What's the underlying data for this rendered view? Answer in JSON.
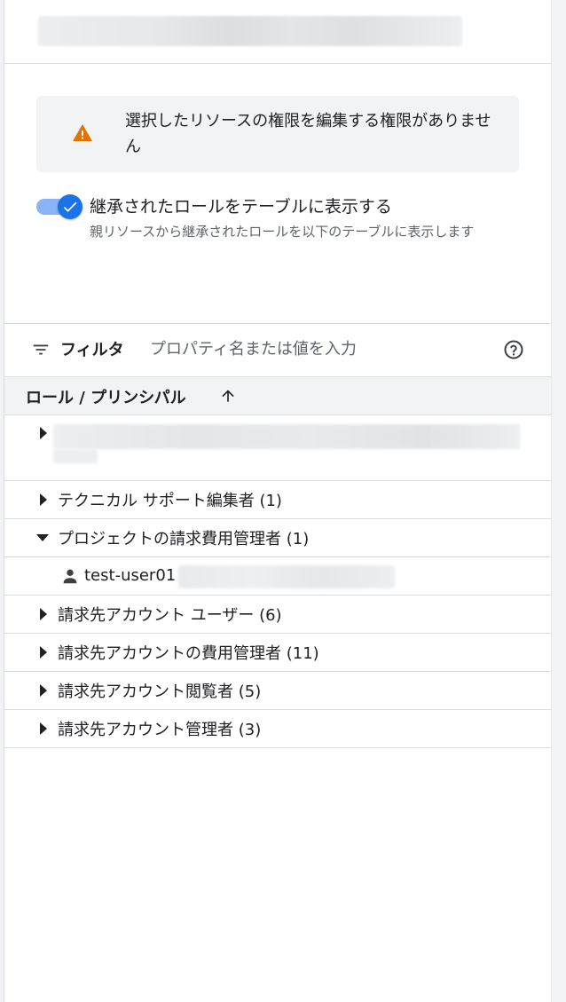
{
  "alert": {
    "message": "選択したリソースの権限を編集する権限がありません"
  },
  "inherited_toggle": {
    "label": "継承されたロールをテーブルに表示する",
    "description": "親リソースから継承されたロールを以下のテーブルに表示します",
    "checked": true
  },
  "filter": {
    "label": "フィルタ",
    "placeholder": "プロパティ名または値を入力"
  },
  "table": {
    "column_header": "ロール / プリンシパル",
    "sort_direction": "ascending",
    "rows": [
      {
        "label": "テクニカル サポート編集者 (1)",
        "expanded": false
      },
      {
        "label": "プロジェクトの請求費用管理者 (1)",
        "expanded": true
      },
      {
        "label": "請求先アカウント ユーザー (6)",
        "expanded": false
      },
      {
        "label": "請求先アカウントの費用管理者 (11)",
        "expanded": false
      },
      {
        "label": "請求先アカウント閲覧者 (5)",
        "expanded": false
      },
      {
        "label": "請求先アカウント管理者 (3)",
        "expanded": false
      }
    ],
    "member": {
      "name": "test-user01"
    }
  },
  "colors": {
    "accent": "#1a73e8",
    "toggle_track": "#8ab4f8",
    "warning": "#e37400",
    "panel_bg": "#f1f3f4",
    "divider": "#dadce0"
  },
  "icons": [
    "warning-icon",
    "check-icon",
    "filter-icon",
    "help-icon",
    "arrow-up-icon",
    "caret-right-icon",
    "caret-down-icon",
    "person-icon"
  ]
}
